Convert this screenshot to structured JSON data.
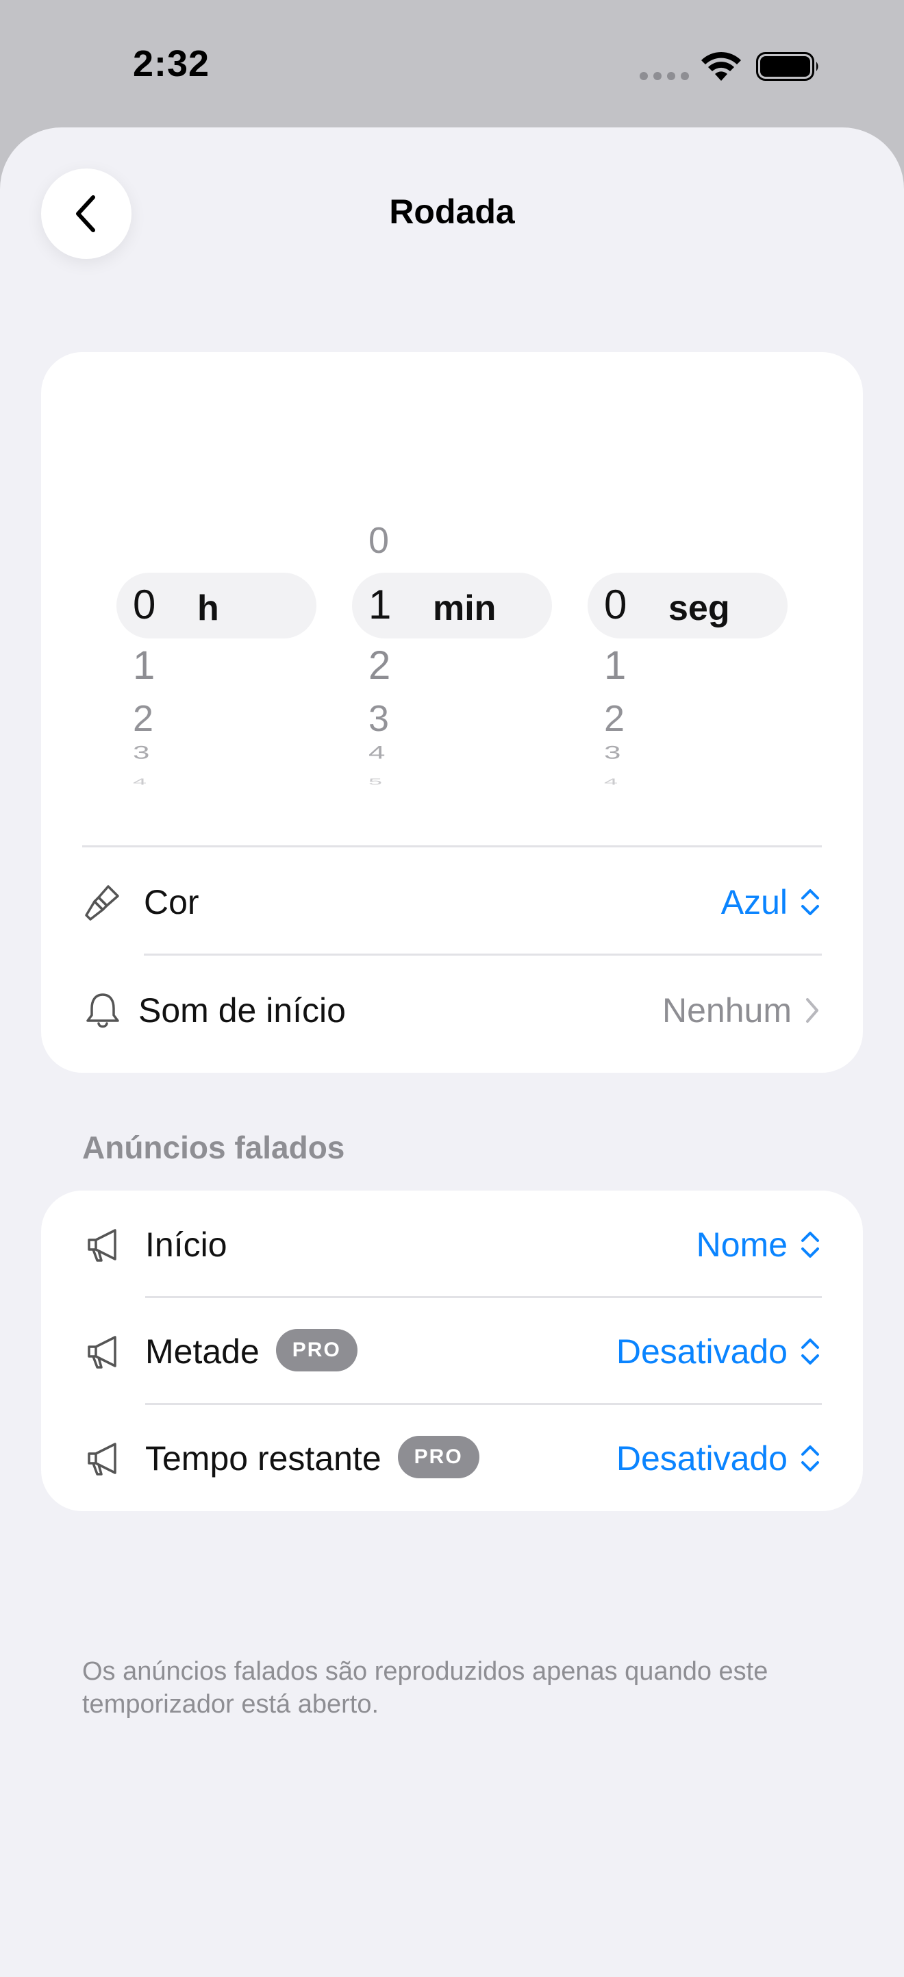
{
  "status_bar": {
    "time": "2:32",
    "icons": [
      "signal-dots-icon",
      "wifi-icon",
      "battery-icon"
    ]
  },
  "nav": {
    "title": "Rodada",
    "back_icon": "chevron-left-icon"
  },
  "picker": {
    "hours": {
      "above": [],
      "selected": "0",
      "unit": "h",
      "below": [
        "1",
        "2",
        "3",
        "4"
      ]
    },
    "minutes": {
      "above": [
        "0"
      ],
      "selected": "1",
      "unit": "min",
      "below": [
        "2",
        "3",
        "4",
        "5"
      ]
    },
    "seconds": {
      "above": [],
      "selected": "0",
      "unit": "seg",
      "below": [
        "1",
        "2",
        "3",
        "4"
      ]
    }
  },
  "settings": {
    "color": {
      "icon": "paintbrush-icon",
      "label": "Cor",
      "value": "Azul",
      "value_icon": "chevron-up-down-icon"
    },
    "start_sound": {
      "icon": "bell-icon",
      "label": "Som de início",
      "value": "Nenhum",
      "value_icon": "chevron-right-icon"
    }
  },
  "announcements": {
    "header": "Anúncios falados",
    "rows": [
      {
        "icon": "megaphone-icon",
        "label": "Início",
        "badge": "",
        "value": "Nome"
      },
      {
        "icon": "megaphone-icon",
        "label": "Metade",
        "badge": "PRO",
        "value": "Desativado"
      },
      {
        "icon": "megaphone-icon",
        "label": "Tempo restante",
        "badge": "PRO",
        "value": "Desativado"
      }
    ],
    "footnote": "Os anúncios falados são reproduzidos apenas quando este temporizador está aberto."
  },
  "colors": {
    "accent": "#0a84ff",
    "background": "#f1f1f6",
    "secondary_text": "#8e8e93"
  }
}
